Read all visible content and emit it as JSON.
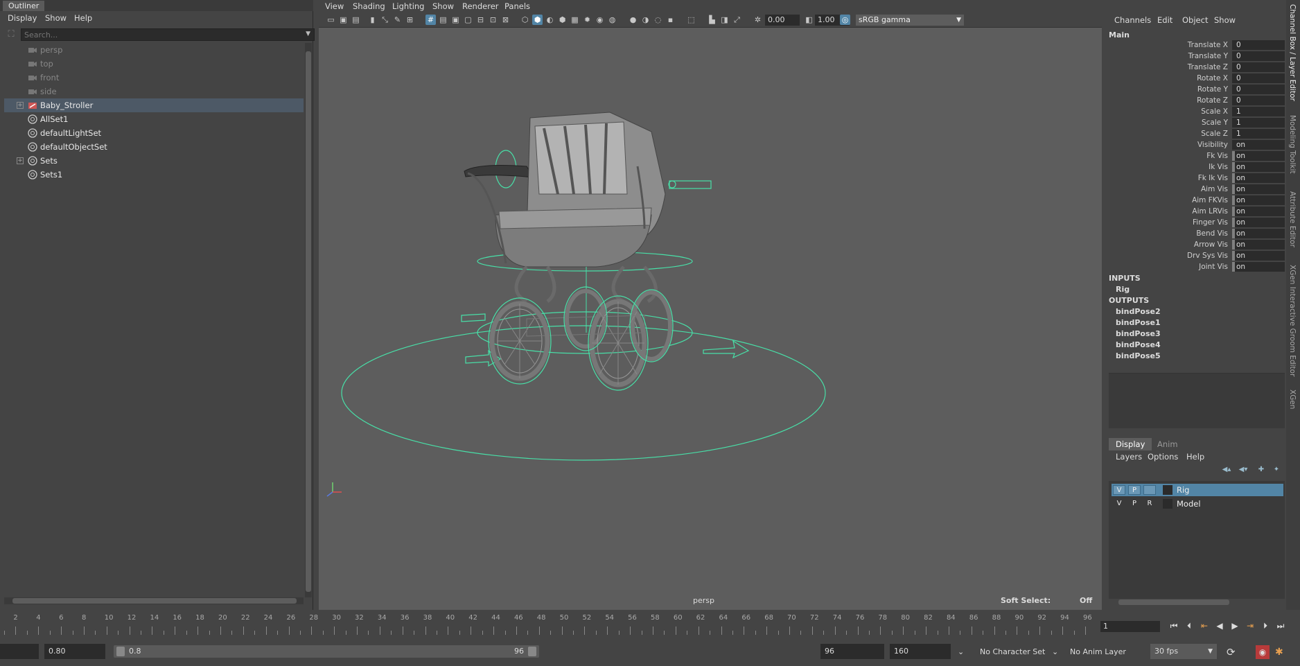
{
  "outliner": {
    "title": "Outliner",
    "menu": [
      "Display",
      "Show",
      "Help"
    ],
    "search_placeholder": "Search...",
    "items": [
      {
        "label": "persp",
        "type": "camera",
        "dim": true
      },
      {
        "label": "top",
        "type": "camera",
        "dim": true
      },
      {
        "label": "front",
        "type": "camera",
        "dim": true
      },
      {
        "label": "side",
        "type": "camera",
        "dim": true
      },
      {
        "label": "Baby_Stroller",
        "type": "group",
        "selected": true
      },
      {
        "label": "AllSet1",
        "type": "set"
      },
      {
        "label": "defaultLightSet",
        "type": "set"
      },
      {
        "label": "defaultObjectSet",
        "type": "set"
      },
      {
        "label": "Sets",
        "type": "set"
      },
      {
        "label": "Sets1",
        "type": "set"
      }
    ]
  },
  "viewport": {
    "menu": [
      "View",
      "Shading",
      "Lighting",
      "Show",
      "Renderer",
      "Panels"
    ],
    "exposure": "0.00",
    "gamma": "1.00",
    "color_space": "sRGB gamma",
    "camera": "persp",
    "soft_select_label": "Soft Select:",
    "soft_select_value": "Off"
  },
  "channel_box": {
    "menu": [
      "Channels",
      "Edit",
      "Object",
      "Show"
    ],
    "object": "Main",
    "attributes": [
      {
        "name": "Translate X",
        "value": "0"
      },
      {
        "name": "Translate Y",
        "value": "0"
      },
      {
        "name": "Translate Z",
        "value": "0"
      },
      {
        "name": "Rotate X",
        "value": "0"
      },
      {
        "name": "Rotate Y",
        "value": "0"
      },
      {
        "name": "Rotate Z",
        "value": "0"
      },
      {
        "name": "Scale X",
        "value": "1"
      },
      {
        "name": "Scale Y",
        "value": "1"
      },
      {
        "name": "Scale Z",
        "value": "1"
      },
      {
        "name": "Visibility",
        "value": "on"
      },
      {
        "name": "Fk Vis",
        "value": "on",
        "keyed": true
      },
      {
        "name": "Ik Vis",
        "value": "on",
        "keyed": true
      },
      {
        "name": "Fk Ik Vis",
        "value": "on",
        "keyed": true
      },
      {
        "name": "Aim Vis",
        "value": "on",
        "keyed": true
      },
      {
        "name": "Aim FKVis",
        "value": "on",
        "keyed": true
      },
      {
        "name": "Aim LRVis",
        "value": "on",
        "keyed": true
      },
      {
        "name": "Finger Vis",
        "value": "on",
        "keyed": true
      },
      {
        "name": "Bend Vis",
        "value": "on",
        "keyed": true
      },
      {
        "name": "Arrow Vis",
        "value": "on",
        "keyed": true
      },
      {
        "name": "Drv Sys Vis",
        "value": "on",
        "keyed": true
      },
      {
        "name": "Joint Vis",
        "value": "on",
        "keyed": true
      }
    ],
    "inputs_label": "INPUTS",
    "inputs": [
      "Rig"
    ],
    "outputs_label": "OUTPUTS",
    "outputs": [
      "bindPose2",
      "bindPose1",
      "bindPose3",
      "bindPose4",
      "bindPose5"
    ]
  },
  "layer_editor": {
    "tabs": [
      "Display",
      "Anim"
    ],
    "menu": [
      "Layers",
      "Options",
      "Help"
    ],
    "layers": [
      {
        "v": "V",
        "p": "P",
        "r": "",
        "name": "Rig",
        "selected": true
      },
      {
        "v": "V",
        "p": "P",
        "r": "R",
        "name": "Model",
        "selected": false
      }
    ]
  },
  "side_tabs": [
    "Channel Box / Layer Editor",
    "Modeling Toolkit",
    "Attribute Editor",
    "XGen Interactive Groom Editor",
    "XGen"
  ],
  "timeline": {
    "ticks": [
      "2",
      "4",
      "6",
      "8",
      "10",
      "12",
      "14",
      "16",
      "18",
      "20",
      "22",
      "24",
      "26",
      "28",
      "30",
      "32",
      "34",
      "36",
      "38",
      "40",
      "42",
      "44",
      "46",
      "48",
      "50",
      "52",
      "54",
      "56",
      "58",
      "60",
      "62",
      "64",
      "66",
      "68",
      "70",
      "72",
      "74",
      "76",
      "78",
      "80",
      "82",
      "84",
      "86",
      "88",
      "90",
      "92",
      "94",
      "96"
    ],
    "current_frame": "1"
  },
  "range": {
    "start_field": "",
    "anim_start": "0.80",
    "slider_start": "0.8",
    "slider_end": "96",
    "playback_end": "96",
    "anim_end": "160",
    "character_set": "No Character Set",
    "anim_layer": "No Anim Layer",
    "fps": "30 fps"
  }
}
